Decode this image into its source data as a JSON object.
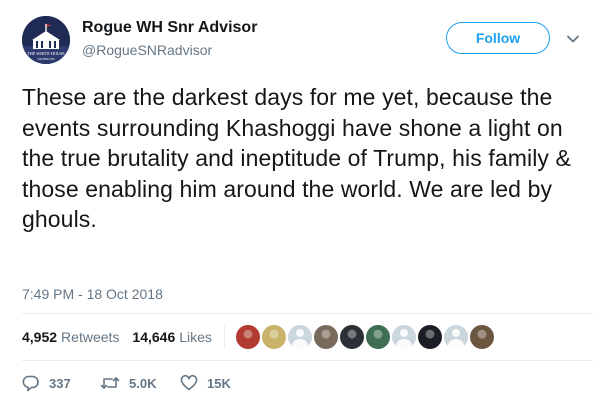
{
  "author": {
    "display_name": "Rogue WH Snr Advisor",
    "handle": "@RogueSNRadvisor",
    "avatar_icon": "white-house-icon",
    "avatar_caption": "THE WHITE HOUSE",
    "avatar_subcaption": "WASHINGTON"
  },
  "follow_button": {
    "label": "Follow",
    "color": "#1da1f2"
  },
  "menu_icon": "chevron-down-icon",
  "tweet": {
    "text": "These are the darkest days for me yet, because the events surrounding Khashoggi have shone a light on the true brutality and ineptitude of Trump, his family & those enabling him around the world. We are led by ghouls.",
    "timestamp": "7:49 PM - 18 Oct 2018"
  },
  "stats": {
    "retweets_count": "4,952",
    "retweets_label": "Retweets",
    "likes_count": "14,646",
    "likes_label": "Likes"
  },
  "liked_by": [
    {
      "name": "liker-1",
      "color": "#b03b2e"
    },
    {
      "name": "liker-2",
      "color": "#c9b26a"
    },
    {
      "name": "liker-3",
      "color": "#ccd6dd"
    },
    {
      "name": "liker-4",
      "color": "#7a6a5c"
    },
    {
      "name": "liker-5",
      "color": "#2b2f36"
    },
    {
      "name": "liker-6",
      "color": "#3f6e55"
    },
    {
      "name": "liker-7",
      "color": "#ccd6dd"
    },
    {
      "name": "liker-8",
      "color": "#1b1e24"
    },
    {
      "name": "liker-9",
      "color": "#ccd6dd"
    },
    {
      "name": "liker-10",
      "color": "#6b5640"
    }
  ],
  "actions": {
    "reply_count": "337",
    "retweet_count": "5.0K",
    "like_count": "15K",
    "icon_color": "#657786"
  }
}
